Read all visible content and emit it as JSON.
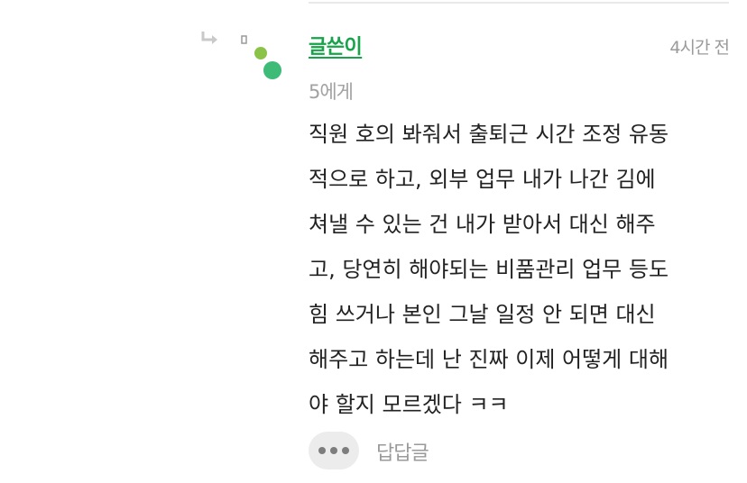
{
  "comment": {
    "author": "글쓴이",
    "timestamp": "4시간 전",
    "mention": "5에게",
    "body_lines": [
      "직원 호의 봐줘서 출퇴근 시간 조정 유동",
      "적으로 하고, 외부 업무 내가 나간 김에",
      "쳐낼 수 있는 건 내가 받아서 대신 해주",
      "고, 당연히 해야되는 비품관리 업무 등도",
      "힘 쓰거나 본인 그날 일정 안 되면 대신",
      "해주고 하는데 난 진짜 이제 어떻게 대해",
      "야 할지 모르겠다 ㅋㅋ"
    ],
    "reply_label": "답답글"
  },
  "icons": {
    "reply_arrow": "reply-arrow-icon",
    "more": "more-options-icon"
  },
  "colors": {
    "author_green": "#16a34a",
    "dot_lime": "#8bc34a",
    "dot_green": "#3dbb77",
    "muted_text": "#9a9a9a"
  }
}
